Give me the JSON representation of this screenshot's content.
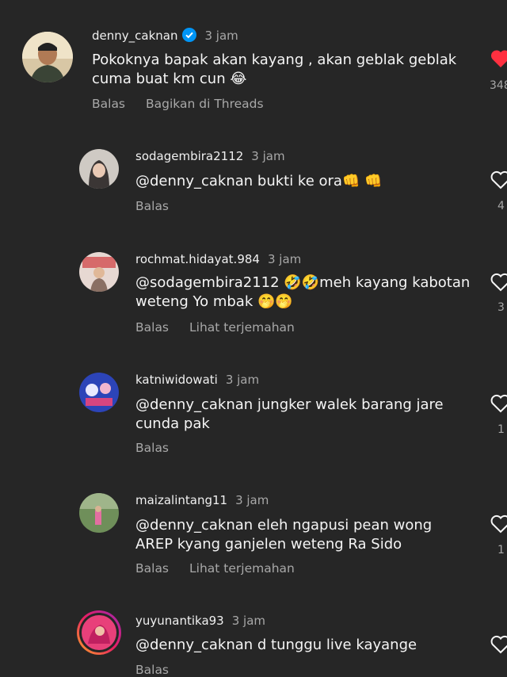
{
  "comments": [
    {
      "username": "denny_caknan",
      "time": "3 jam",
      "verified": true,
      "lines": [
        "Pokoknya bapak akan kayang , akan geblak geblak",
        "cuma buat km cun 😂"
      ],
      "actions": [
        "Balas",
        "Bagikan di Threads"
      ],
      "liked": true,
      "like_count": "348"
    },
    {
      "username": "sodagembira2112",
      "time": "3 jam",
      "lines": [
        "@denny_caknan bukti ke ora👊 👊"
      ],
      "actions": [
        "Balas"
      ],
      "like_count": "4"
    },
    {
      "username": "rochmat.hidayat.984",
      "time": "3 jam",
      "lines": [
        "@sodagembira2112 🤣🤣meh kayang kabotan",
        "weteng Yo mbak 🤭🤭"
      ],
      "actions": [
        "Balas",
        "Lihat terjemahan"
      ],
      "like_count": "3"
    },
    {
      "username": "katniwidowati",
      "time": "3 jam",
      "lines": [
        "@denny_caknan jungker walek barang jare",
        "cunda pak"
      ],
      "actions": [
        "Balas"
      ],
      "like_count": "1"
    },
    {
      "username": "maizalintang11",
      "time": "3 jam",
      "lines": [
        "@denny_caknan eleh ngapusi pean wong",
        "AREP kyang ganjelen weteng Ra Sido"
      ],
      "actions": [
        "Balas",
        "Lihat terjemahan"
      ],
      "like_count": "1"
    },
    {
      "username": "yuyunantika93",
      "time": "3 jam",
      "lines": [
        "@denny_caknan d tunggu live kayange"
      ],
      "actions": [
        "Balas"
      ]
    }
  ],
  "colors": {
    "background": "#262626",
    "muted_text": "#a8a8a8",
    "like_active": "#ff3040",
    "verified_badge": "#0095f6"
  }
}
